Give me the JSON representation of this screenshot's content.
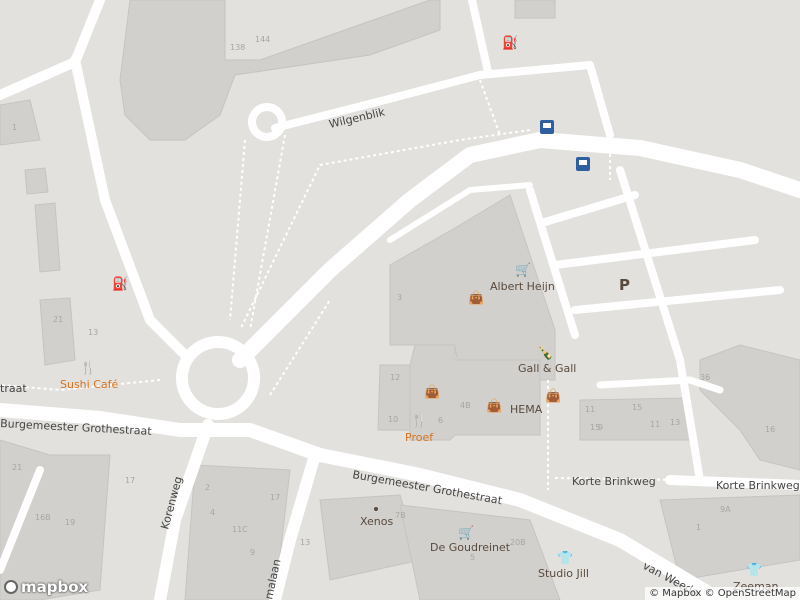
{
  "colors": {
    "background": "#e3e1de",
    "building": "#d2d0cd",
    "building_outline": "#c6c4c1",
    "road": "#ffffff",
    "path": "#ffffff",
    "poi_orange": "#d8731f",
    "poi_brown": "#5a4a3d",
    "bus_stop": "#2f5f9e"
  },
  "streets": {
    "wilgenblik": "Wilgenblik",
    "burgemeester_left": "Burgemeester Grothestraat",
    "burgemeester_right": "Burgemeester Grothestraat",
    "korenweg": "Korenweg",
    "korte_brinkweg_1": "Korte Brinkweg",
    "korte_brinkweg_2": "Korte Brinkweg",
    "van_weede": "van Weede",
    "partial_laan": "malaan",
    "partial_left": "traat"
  },
  "pois": {
    "albert_heijn": {
      "name": "Albert Heijn",
      "icon": "cart-icon"
    },
    "gall_gall": {
      "name": "Gall & Gall",
      "icon": "bottle-icon"
    },
    "hema": {
      "name": "HEMA",
      "icon": "shopping-bag-icon"
    },
    "proef": {
      "name": "Proef",
      "icon": "restaurant-icon"
    },
    "sushi": {
      "name": "Sushi Café",
      "icon": "restaurant-icon"
    },
    "xenos": {
      "name": "Xenos",
      "icon": "dot-icon"
    },
    "goudreinet": {
      "name": "De Goudreinet",
      "icon": "cart-icon"
    },
    "studio_jill": {
      "name": "Studio Jill",
      "icon": "shirt-icon"
    },
    "zeeman": {
      "name": "Zeeman",
      "icon": "shirt-icon"
    },
    "parking": {
      "name": "P",
      "icon": "parking-icon"
    }
  },
  "house_numbers": [
    "138",
    "144",
    "3",
    "12",
    "10",
    "6",
    "4B",
    "11",
    "15",
    "13",
    "21",
    "17",
    "19",
    "16B",
    "4",
    "2",
    "1",
    "21",
    "13",
    "15",
    "11",
    "17",
    "13",
    "7B",
    "11C",
    "9",
    "5",
    "20B",
    "1",
    "9A",
    "9",
    "16",
    "36"
  ],
  "attribution": "© Mapbox © OpenStreetMap",
  "logo": "mapbox"
}
